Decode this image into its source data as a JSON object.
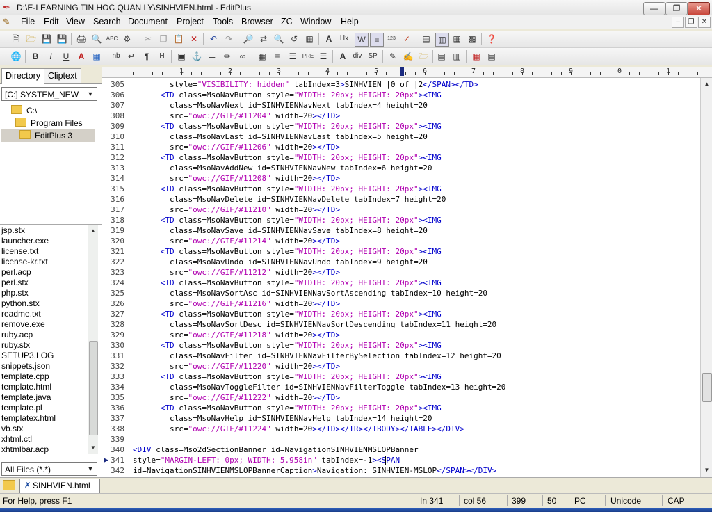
{
  "window": {
    "title": "D:\\E-LEARNING TIN HOC QUAN LY\\SINHVIEN.html - EditPlus"
  },
  "menu": [
    "File",
    "Edit",
    "View",
    "Search",
    "Document",
    "Project",
    "Tools",
    "Browser",
    "ZC",
    "Window",
    "Help"
  ],
  "panel": {
    "tabs": [
      "Directory",
      "Cliptext"
    ],
    "drive": "[C:] SYSTEM_NEW",
    "tree": [
      "C:\\",
      "Program Files",
      "EditPlus 3"
    ],
    "files": [
      "jsp.stx",
      "launcher.exe",
      "license.txt",
      "license-kr.txt",
      "perl.acp",
      "perl.stx",
      "php.stx",
      "python.stx",
      "readme.txt",
      "remove.exe",
      "ruby.acp",
      "ruby.stx",
      "SETUP3.LOG",
      "snippets.json",
      "template.cpp",
      "template.html",
      "template.java",
      "template.pl",
      "templatex.html",
      "vb.stx",
      "xhtml.ctl",
      "xhtmlbar.acp"
    ],
    "filter": "All Files (*.*)"
  },
  "ruler": [
    "1",
    "2",
    "3",
    "4",
    "5",
    "6",
    "7",
    "8",
    "9",
    "0",
    "1"
  ],
  "editor": {
    "lines": [
      {
        "n": "305",
        "t": "        style=\"VISIBILITY: hidden\" tabIndex=3>SINHVIEN |0 of |2</SPAN></TD>"
      },
      {
        "n": "306",
        "t": "      <TD class=MsoNavButton style=\"WIDTH: 20px; HEIGHT: 20px\"><IMG"
      },
      {
        "n": "307",
        "t": "        class=MsoNavNext id=SINHVIENNavNext tabIndex=4 height=20"
      },
      {
        "n": "308",
        "t": "        src=\"owc://GIF/#11204\" width=20></TD>"
      },
      {
        "n": "309",
        "t": "      <TD class=MsoNavButton style=\"WIDTH: 20px; HEIGHT: 20px\"><IMG"
      },
      {
        "n": "310",
        "t": "        class=MsoNavLast id=SINHVIENNavLast tabIndex=5 height=20"
      },
      {
        "n": "311",
        "t": "        src=\"owc://GIF/#11206\" width=20></TD>"
      },
      {
        "n": "312",
        "t": "      <TD class=MsoNavButton style=\"WIDTH: 20px; HEIGHT: 20px\"><IMG"
      },
      {
        "n": "313",
        "t": "        class=MsoNavAddNew id=SINHVIENNavNew tabIndex=6 height=20"
      },
      {
        "n": "314",
        "t": "        src=\"owc://GIF/#11208\" width=20></TD>"
      },
      {
        "n": "315",
        "t": "      <TD class=MsoNavButton style=\"WIDTH: 20px; HEIGHT: 20px\"><IMG"
      },
      {
        "n": "316",
        "t": "        class=MsoNavDelete id=SINHVIENNavDelete tabIndex=7 height=20"
      },
      {
        "n": "317",
        "t": "        src=\"owc://GIF/#11210\" width=20></TD>"
      },
      {
        "n": "318",
        "t": "      <TD class=MsoNavButton style=\"WIDTH: 20px; HEIGHT: 20px\"><IMG"
      },
      {
        "n": "319",
        "t": "        class=MsoNavSave id=SINHVIENNavSave tabIndex=8 height=20"
      },
      {
        "n": "320",
        "t": "        src=\"owc://GIF/#11214\" width=20></TD>"
      },
      {
        "n": "321",
        "t": "      <TD class=MsoNavButton style=\"WIDTH: 20px; HEIGHT: 20px\"><IMG"
      },
      {
        "n": "322",
        "t": "        class=MsoNavUndo id=SINHVIENNavUndo tabIndex=9 height=20"
      },
      {
        "n": "323",
        "t": "        src=\"owc://GIF/#11212\" width=20></TD>"
      },
      {
        "n": "324",
        "t": "      <TD class=MsoNavButton style=\"WIDTH: 20px; HEIGHT: 20px\"><IMG"
      },
      {
        "n": "325",
        "t": "        class=MsoNavSortAsc id=SINHVIENNavSortAscending tabIndex=10 height=20"
      },
      {
        "n": "326",
        "t": "        src=\"owc://GIF/#11216\" width=20></TD>"
      },
      {
        "n": "327",
        "t": "      <TD class=MsoNavButton style=\"WIDTH: 20px; HEIGHT: 20px\"><IMG"
      },
      {
        "n": "328",
        "t": "        class=MsoNavSortDesc id=SINHVIENNavSortDescending tabIndex=11 height=20"
      },
      {
        "n": "329",
        "t": "        src=\"owc://GIF/#11218\" width=20></TD>"
      },
      {
        "n": "330",
        "t": "      <TD class=MsoNavButton style=\"WIDTH: 20px; HEIGHT: 20px\"><IMG"
      },
      {
        "n": "331",
        "t": "        class=MsoNavFilter id=SINHVIENNavFilterBySelection tabIndex=12 height=20"
      },
      {
        "n": "332",
        "t": "        src=\"owc://GIF/#11220\" width=20></TD>"
      },
      {
        "n": "333",
        "t": "      <TD class=MsoNavButton style=\"WIDTH: 20px; HEIGHT: 20px\"><IMG"
      },
      {
        "n": "334",
        "t": "        class=MsoNavToggleFilter id=SINHVIENNavFilterToggle tabIndex=13 height=20"
      },
      {
        "n": "335",
        "t": "        src=\"owc://GIF/#11222\" width=20></TD>"
      },
      {
        "n": "336",
        "t": "      <TD class=MsoNavButton style=\"WIDTH: 20px; HEIGHT: 20px\"><IMG"
      },
      {
        "n": "337",
        "t": "        class=MsoNavHelp id=SINHVIENNavHelp tabIndex=14 height=20"
      },
      {
        "n": "338",
        "t": "        src=\"owc://GIF/#11224\" width=20></TD></TR></TBODY></TABLE></DIV>"
      },
      {
        "n": "339",
        "t": ""
      },
      {
        "n": "340",
        "t": "<DIV class=Mso2dSectionBanner id=NavigationSINHVIENMSLOPBanner"
      },
      {
        "n": "341",
        "t": "style=\"MARGIN-LEFT: 0px; WIDTH: 5.958in\" tabIndex=-1><SPAN"
      },
      {
        "n": "342",
        "t": "id=NavigationSINHVIENMSLOPBannerCaption>Navigation: SINHVIEN-MSLOP</SPAN></DIV>"
      }
    ]
  },
  "doctab": {
    "label": "SINHVIEN.html"
  },
  "status": {
    "help": "For Help, press F1",
    "ln": "In 341",
    "col": "col 56",
    "total": "399",
    "n2": "50",
    "mode": "PC",
    "enc": "Unicode",
    "cap": "CAP"
  },
  "colors": {
    "tag": "#0000cc",
    "string": "#b000b0",
    "attr": "#000000"
  },
  "icons": [
    "new-file-icon",
    "open-icon",
    "save-icon",
    "save-all-icon",
    "print-icon",
    "print-preview-icon",
    "spellcheck-icon",
    "cut-icon",
    "copy-icon",
    "paste-icon",
    "delete-icon",
    "undo-icon",
    "redo-icon",
    "find-icon",
    "replace-icon",
    "word-wrap-icon",
    "ruler-icon",
    "browser-icon"
  ]
}
